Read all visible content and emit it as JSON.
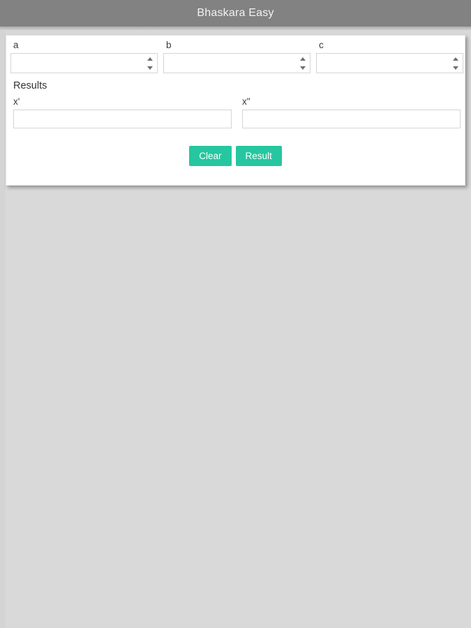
{
  "app": {
    "title": "Bhaskara Easy",
    "accent_color": "#26c6a0",
    "titlebar_color": "#828282",
    "background_color": "#d9d9d9"
  },
  "form": {
    "coefficients": [
      {
        "label": "a",
        "value": "",
        "placeholder": "",
        "icon": "spinner-icon"
      },
      {
        "label": "b",
        "value": "",
        "placeholder": "",
        "icon": "spinner-icon"
      },
      {
        "label": "c",
        "value": "",
        "placeholder": "",
        "icon": "spinner-icon"
      }
    ],
    "results_heading": "Results",
    "results": [
      {
        "label": "x'",
        "value": "",
        "placeholder": ""
      },
      {
        "label": "x\"",
        "value": "",
        "placeholder": ""
      }
    ],
    "buttons": [
      {
        "label": "Clear",
        "name": "clear-button"
      },
      {
        "label": "Result",
        "name": "result-button"
      }
    ]
  }
}
